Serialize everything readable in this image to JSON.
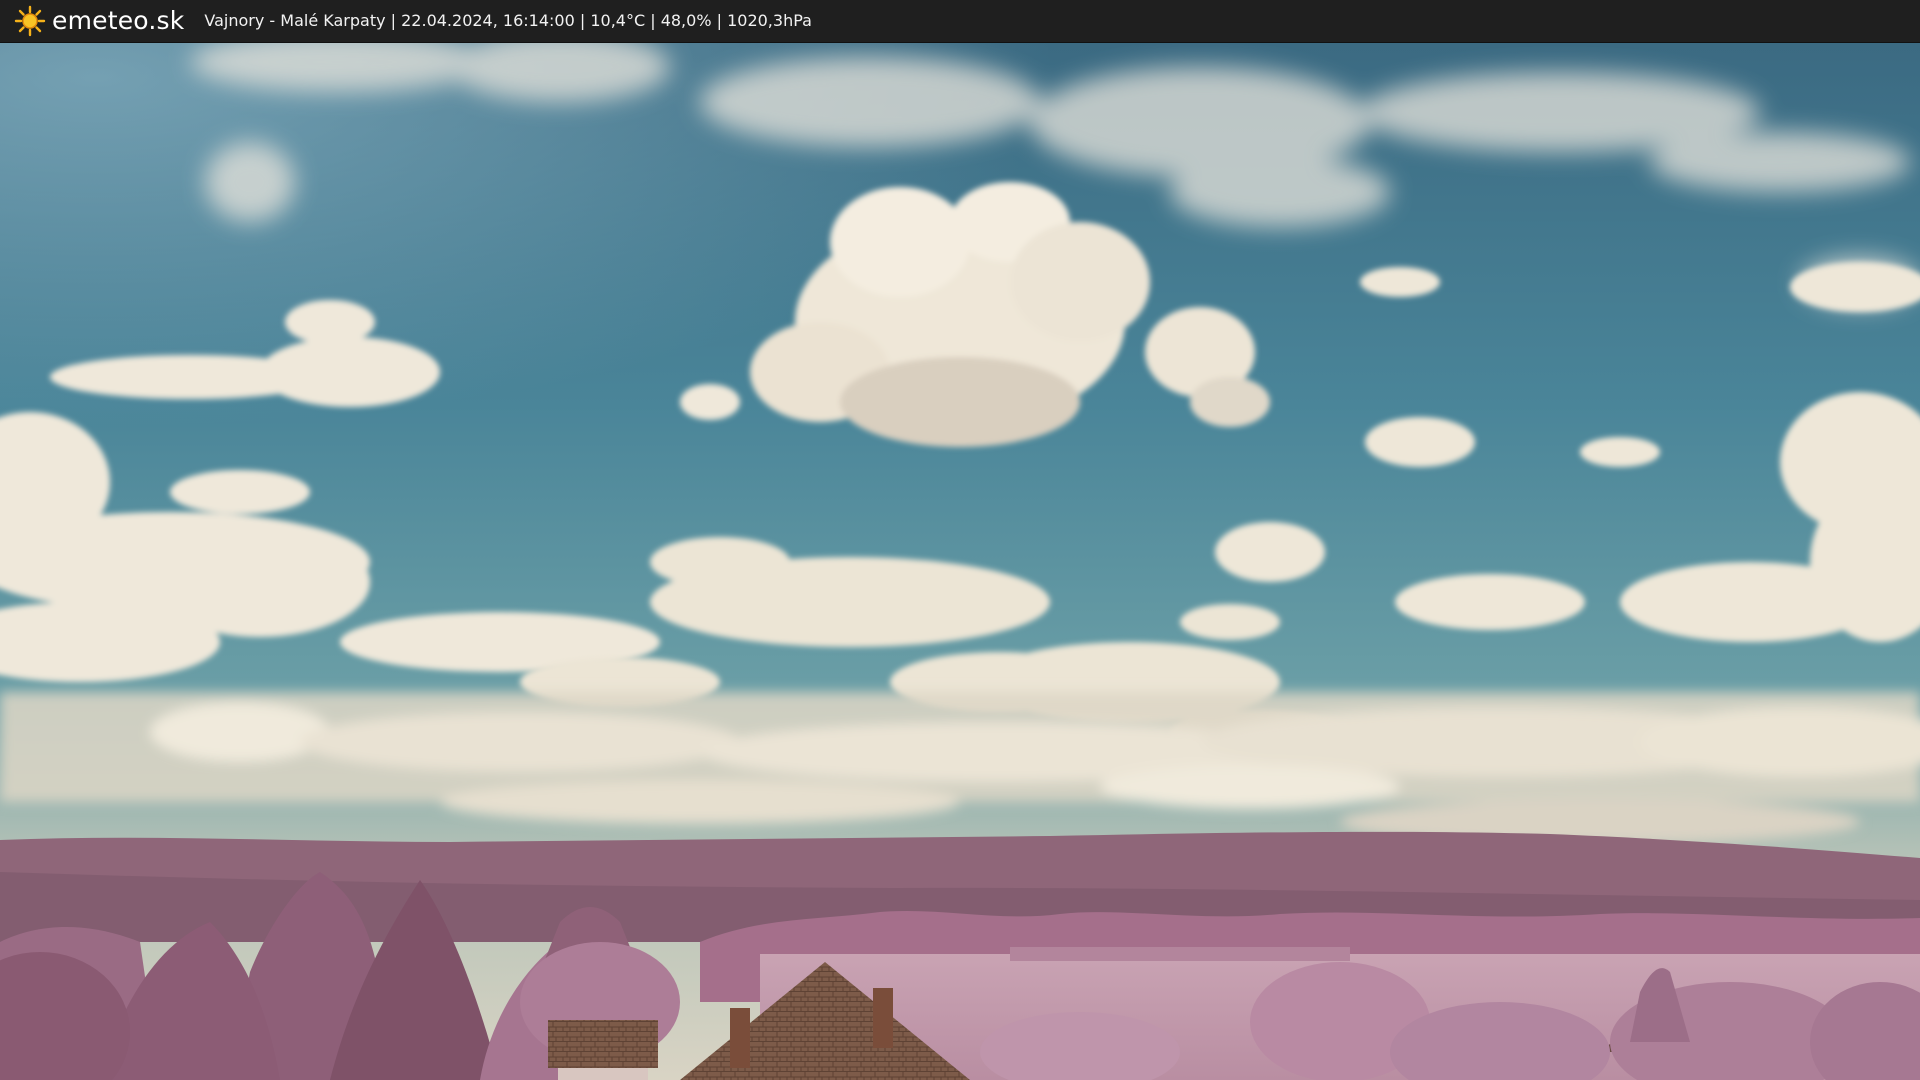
{
  "header": {
    "brand": "emeteo.sk",
    "logo_icon": "sun-icon",
    "info_text": "Vajnory - Malé Karpaty | 22.04.2024, 16:14:00 | 10,4°C | 48,0% | 1020,3hPa"
  },
  "colors": {
    "sky_top": "#3f6f86",
    "sky_mid": "#4d8a9c",
    "sky_horizon": "#9fb5b0",
    "cloud": "#f1eadb",
    "vegetation": "#a87591",
    "hills": "#8c6478",
    "field": "#c8a6b2",
    "roof": "#7a5a48",
    "bar": "#1f1f1f"
  }
}
